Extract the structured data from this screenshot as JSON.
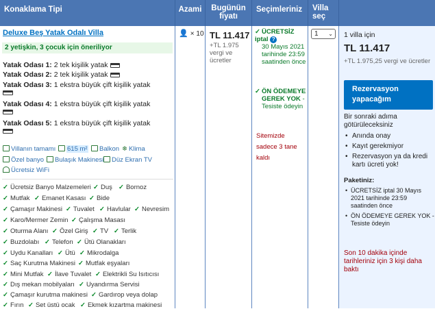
{
  "headers": {
    "type": "Konaklama Tipi",
    "max": "Azami",
    "price": "Bugünün fiyatı",
    "choices": "Seçimleriniz",
    "select": "Villa seç"
  },
  "room": {
    "title": "Deluxe Beş Yatak Odalı Villa",
    "recommend": "2 yetişkin, 3 çocuk için öneriliyor",
    "beds": [
      {
        "name": "Yatak Odası 1:",
        "desc": "2 tek kişilik yatak"
      },
      {
        "name": "Yatak Odası 2:",
        "desc": "2 tek kişilik yatak"
      },
      {
        "name": "Yatak Odası 3:",
        "desc": "1 ekstra büyük çift kişilik yatak"
      },
      {
        "name": "Yatak Odası 4:",
        "desc": "1 ekstra büyük çift kişilik yatak"
      },
      {
        "name": "Yatak Odası 5:",
        "desc": "1 ekstra büyük çift kişilik yatak"
      }
    ],
    "facilities": {
      "villa": "Villanın tamamı",
      "size": "615 m²",
      "balcony": "Balkon",
      "ac": "Klima",
      "bath": "Özel banyo",
      "dishwasher": "Bulaşık Makinesi",
      "tv": "Düz Ekran TV",
      "wifi": "Ücretsiz WiFi"
    },
    "amenities": [
      "Ücretsiz Banyo Malzemeleri",
      "Duş",
      "Bornoz",
      "Mutfak",
      "Emanet Kasası",
      "Bide",
      "Çamaşır Makinesi",
      "Tuvalet",
      "Havlular",
      "Nevresim",
      "Karo/Mermer Zemin",
      "Çalışma Masası",
      "Oturma Alanı",
      "Özel Giriş",
      "TV",
      "Terlik",
      "Buzdolabı",
      "Telefon",
      "Ütü Olanakları",
      "Uydu Kanalları",
      "Ütü",
      "Mikrodalga",
      "Saç Kurutma Makinesi",
      "Mutfak eşyaları",
      "Mini Mutfak",
      "İlave Tuvalet",
      "Elektrikli Su Isıtıcısı",
      "Dış mekan mobilyaları",
      "Uyandırma Servisi",
      "Çamaşır kurutma makinesi",
      "Gardırop veya dolap",
      "Fırın",
      "Set üstü ocak",
      "Ekmek kızartma makinesi"
    ]
  },
  "max": {
    "count": "× 10"
  },
  "price": {
    "amount": "TL 11.417",
    "tax": "+TL 1.975 vergi ve ücretler"
  },
  "choices": {
    "free_cancel_title": "ÜCRETSİZ iptal",
    "free_cancel_date": "30 Mayıs 2021 tarihinde 23:59 saatinden önce",
    "prepay_title": "ÖN ÖDEMEYE GEREK YOK",
    "prepay_desc": "- Tesiste ödeyin",
    "warning": "Sitemizde sadece 3 tane kaldı"
  },
  "select": {
    "value": "1"
  },
  "summary": {
    "villa_for": "1 villa için",
    "price": "TL 11.417",
    "tax": "+TL 1.975,25 vergi ve ücretler",
    "cta": "Rezervasyon yapacağım",
    "next": "Bir sonraki adıma götürüleceksiniz",
    "bullets": [
      "Anında onay",
      "Kayıt gerekmiyor",
      "Rezervasyon ya da kredi kartı ücreti yok!"
    ],
    "package_title": "Paketiniz:",
    "package_items": [
      "ÜCRETSİZ iptal 30 Mayıs 2021 tarihinde 23:59 saatinden önce",
      "ÖN ÖDEMEYE GEREK YOK - Tesiste ödeyin"
    ],
    "last_booked": "Son 10 dakika içinde tarihleriniz için 3 kişi daha baktı"
  },
  "colors": {
    "header": "#4b76b3",
    "accent": "#0071c2",
    "green": "#0a7a2a",
    "red": "#a3000a"
  }
}
